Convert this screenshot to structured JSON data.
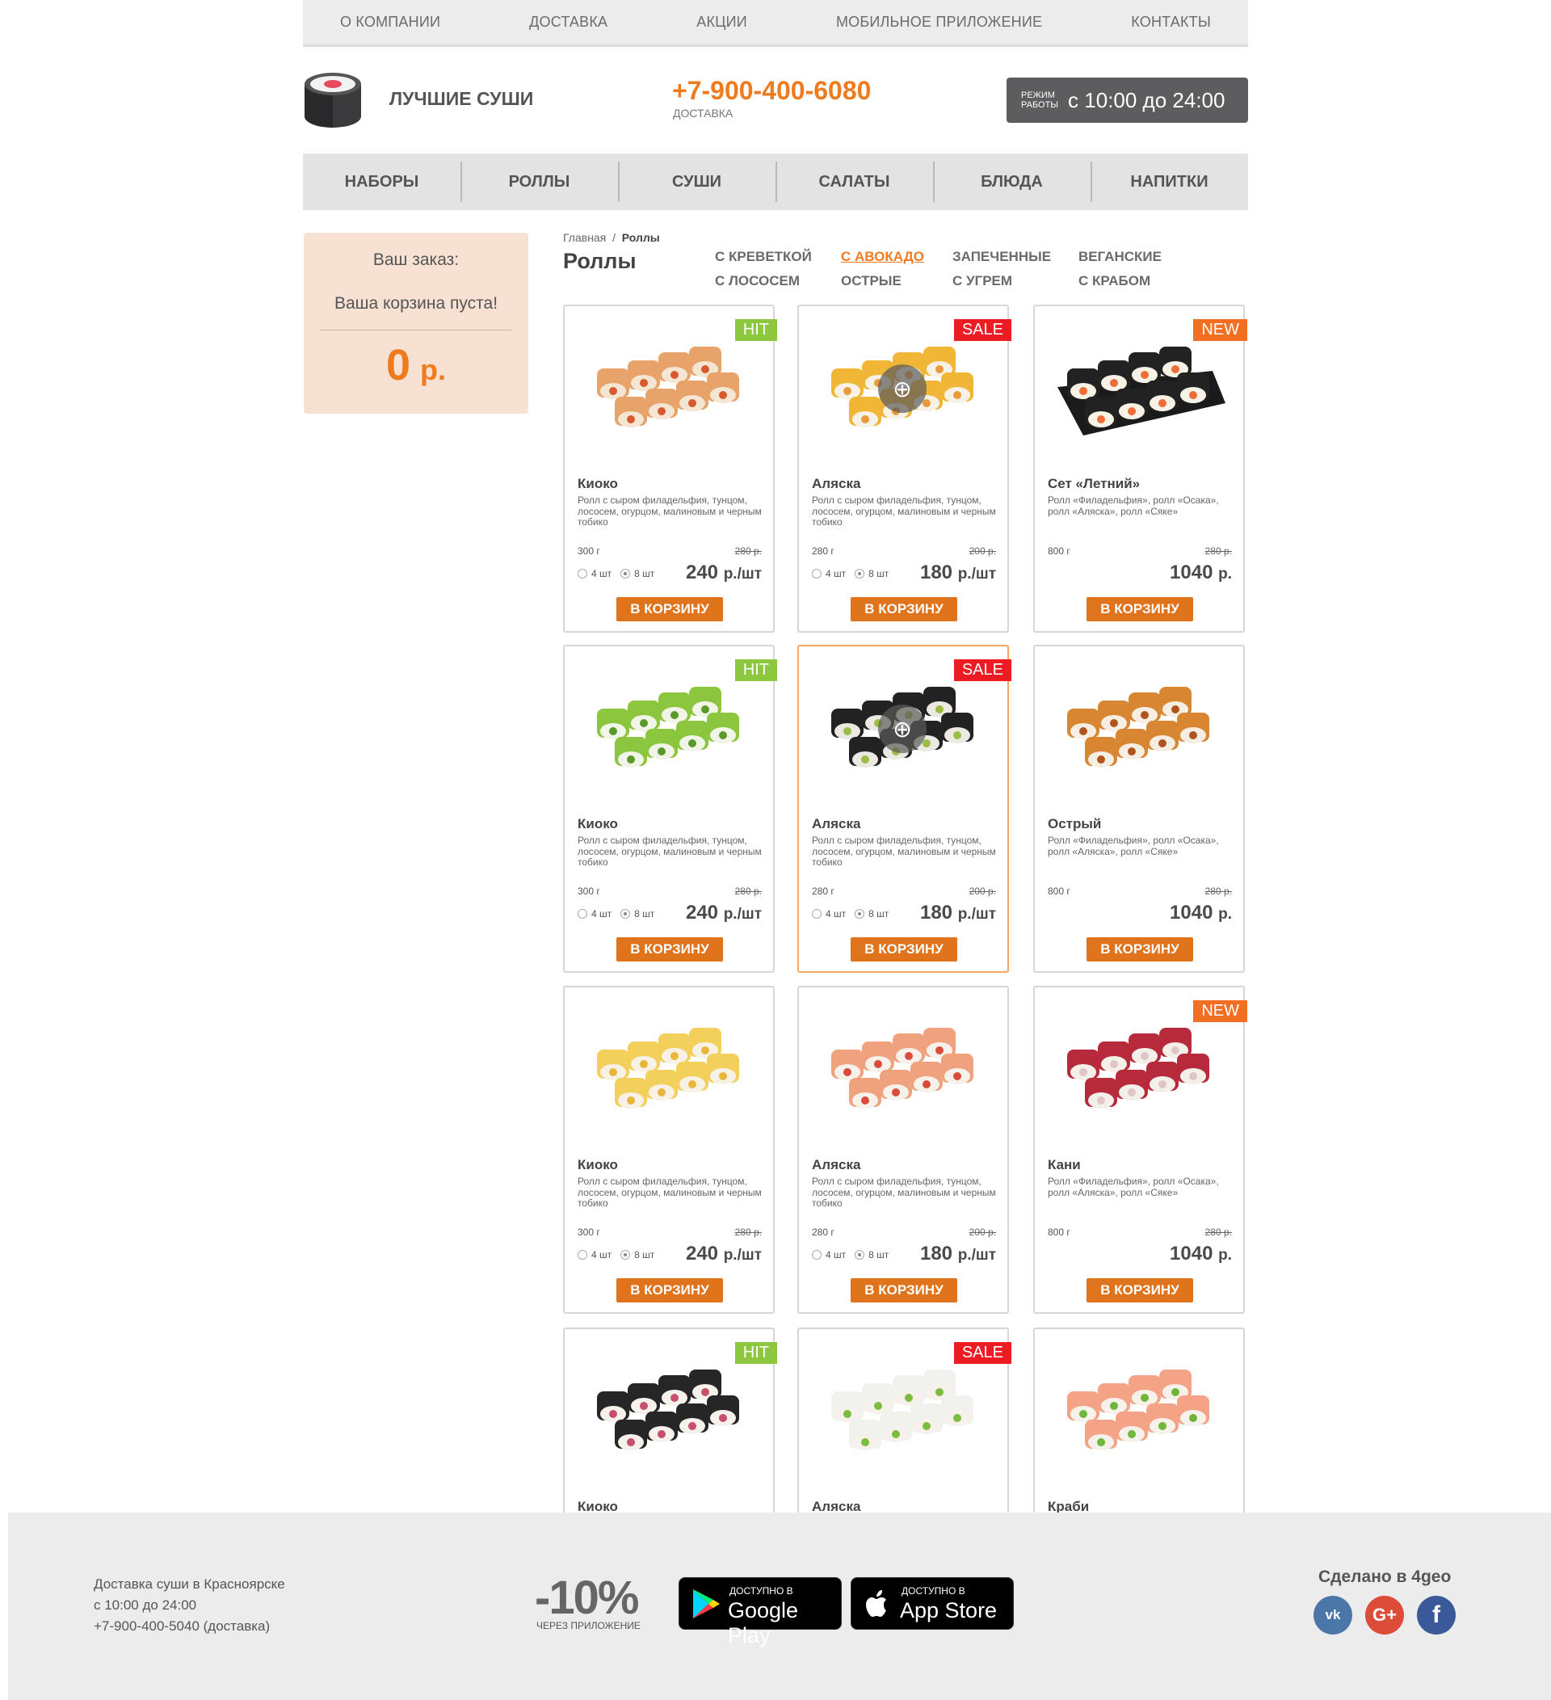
{
  "topnav": [
    "О КОМПАНИИ",
    "ДОСТАВКА",
    "АКЦИИ",
    "МОБИЛЬНОЕ ПРИЛОЖЕНИЕ",
    "КОНТАКТЫ"
  ],
  "header": {
    "brand": "ЛУЧШИЕ СУШИ",
    "phone": "+7-900-400-6080",
    "phone_sub": "ДОСТАВКА",
    "hours_label_1": "РЕЖИМ",
    "hours_label_2": "РАБОТЫ",
    "hours_value": "с 10:00 до 24:00"
  },
  "catnav": [
    "НАБОРЫ",
    "РОЛЛЫ",
    "СУШИ",
    "САЛАТЫ",
    "БЛЮДА",
    "НАПИТКИ"
  ],
  "cart": {
    "title": "Ваш заказ:",
    "empty": "Ваша корзина пуста!",
    "sum": "0",
    "currency": "р."
  },
  "breadcrumb": {
    "home": "Главная",
    "sep": "/",
    "current": "Роллы"
  },
  "page_title": "Роллы",
  "subcats": [
    {
      "label": "С КРЕВЕТКОЙ",
      "active": false
    },
    {
      "label": "С АВОКАДО",
      "active": true
    },
    {
      "label": "ЗАПЕЧЕННЫЕ",
      "active": false
    },
    {
      "label": "ВЕГАНСКИЕ",
      "active": false
    },
    {
      "label": "С ЛОСОСЕМ",
      "active": false
    },
    {
      "label": "ОСТРЫЕ",
      "active": false
    },
    {
      "label": "С УГРЕМ",
      "active": false
    },
    {
      "label": "С КРАБОМ",
      "active": false
    }
  ],
  "colors": {
    "accent": "#ef7b1e",
    "button": "#e0741d",
    "hit": "#8dc63f",
    "sale": "#ed1c24",
    "new": "#f26f21"
  },
  "labels": {
    "buy": "В КОРЗИНУ",
    "qty4": "4 шт",
    "qty8": "8 шт"
  },
  "products": [
    {
      "badge": "HIT",
      "name": "Киоко",
      "desc": "Ролл с сыром филадельфия, тунцом, лососем, огурцом, малиновым и черным тобико",
      "weight": "300 г",
      "old": "280 р.",
      "price": "240",
      "unit": "р./шт",
      "qty": true,
      "roll": "tempura"
    },
    {
      "badge": "SALE",
      "name": "Аляска",
      "desc": "Ролл с сыром филадельфия, тунцом, лососем, огурцом, малиновым и черным тобико",
      "weight": "280 г",
      "old": "200 р.",
      "price": "180",
      "unit": "р./шт",
      "qty": true,
      "zoom": true,
      "roll": "yellow"
    },
    {
      "badge": "NEW",
      "name": "Сет «Летний»",
      "desc": "Ролл «Филадельфия», ролл «Осака», ролл «Аляска», ролл «Сяке»",
      "weight": "800 г",
      "old": "280 р.",
      "price": "1040",
      "unit": "р.",
      "qty": false,
      "roll": "set"
    },
    {
      "badge": "HIT",
      "name": "Киоко",
      "desc": "Ролл с сыром филадельфия, тунцом, лососем, огурцом, малиновым и черным тобико",
      "weight": "300 г",
      "old": "280 р.",
      "price": "240",
      "unit": "р./шт",
      "qty": true,
      "roll": "cucumber"
    },
    {
      "badge": "SALE",
      "name": "Аляска",
      "desc": "Ролл с сыром филадельфия, тунцом, лососем, огурцом, малиновым и черным тобико",
      "weight": "280 г",
      "old": "200 р.",
      "price": "180",
      "unit": "р./шт",
      "qty": true,
      "zoom": true,
      "selected": true,
      "roll": "black"
    },
    {
      "badge": "",
      "name": "Острый",
      "desc": "Ролл «Филадельфия», ролл «Осака», ролл «Аляска», ролл «Сяке»",
      "weight": "800 г",
      "old": "280 р.",
      "price": "1040",
      "unit": "р.",
      "qty": false,
      "roll": "eel"
    },
    {
      "badge": "",
      "name": "Киоко",
      "desc": "Ролл с сыром филадельфия, тунцом, лососем, огурцом, малиновым и черным тобико",
      "weight": "300 г",
      "old": "280 р.",
      "price": "240",
      "unit": "р./шт",
      "qty": true,
      "roll": "omelet"
    },
    {
      "badge": "",
      "name": "Аляска",
      "desc": "Ролл с сыром филадельфия, тунцом, лососем, огурцом, малиновым и черным тобико",
      "weight": "280 г",
      "old": "200 р.",
      "price": "180",
      "unit": "р./шт",
      "qty": true,
      "roll": "salmon"
    },
    {
      "badge": "NEW",
      "name": "Кани",
      "desc": "Ролл «Филадельфия», ролл «Осака», ролл «Аляска», ролл «Сяке»",
      "weight": "800 г",
      "old": "280 р.",
      "price": "1040",
      "unit": "р.",
      "qty": false,
      "roll": "red"
    },
    {
      "badge": "HIT",
      "name": "Киоко",
      "roll": "nori"
    },
    {
      "badge": "SALE",
      "name": "Аляска",
      "roll": "salad"
    },
    {
      "badge": "",
      "name": "Краби",
      "roll": "pink"
    }
  ],
  "footer": {
    "address_1": "Доставка суши в Красноярске",
    "address_2": "с 10:00 до 24:00",
    "address_3": "+7-900-400-5040 (доставка)",
    "discount": "-10%",
    "discount_sub": "ЧЕРЕЗ ПРИЛОЖЕНИЕ",
    "gplay_small": "ДОСТУПНО В",
    "gplay_big": "Google Play",
    "appstore_small": "ДОСТУПНО В",
    "appstore_big": "App Store",
    "made_by": "Сделано в 4geo",
    "social": [
      {
        "icon": "vk-icon",
        "text": "vk"
      },
      {
        "icon": "google-plus-icon",
        "text": "G+"
      },
      {
        "icon": "facebook-icon",
        "text": "f"
      }
    ]
  }
}
